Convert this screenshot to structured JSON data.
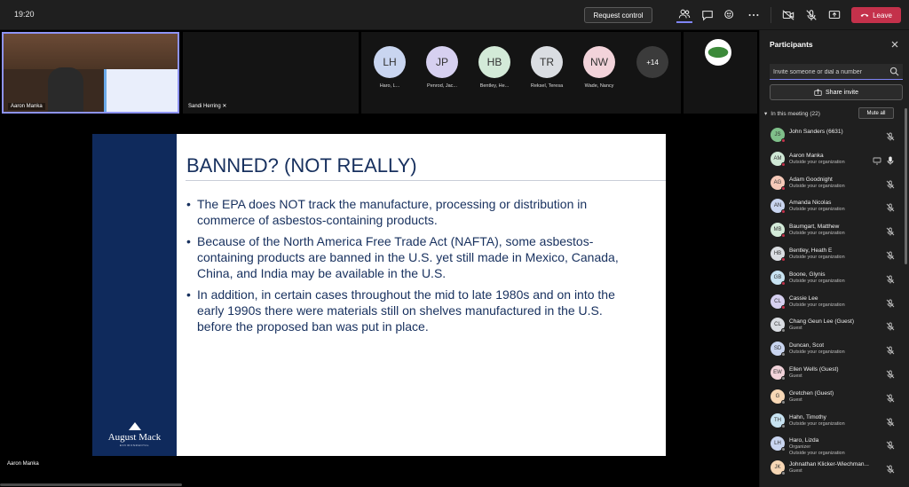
{
  "topbar": {
    "clock": "19:20",
    "request_control": "Request control",
    "leave": "Leave"
  },
  "videos": {
    "self_name": "Aaron Manka",
    "sandi_name": "Sandi Herring",
    "more_count": "+14",
    "tiles": [
      {
        "initials": "LH",
        "caption": "Haro, L...",
        "color": "#c9d5f0"
      },
      {
        "initials": "JP",
        "caption": "Penrod, Jac...",
        "color": "#d6d0f0"
      },
      {
        "initials": "HB",
        "caption": "Bentley, He...",
        "color": "#d3ead8"
      },
      {
        "initials": "TR",
        "caption": "Reksel, Teresa",
        "color": "#dadde2"
      },
      {
        "initials": "NW",
        "caption": "Wade, Nancy",
        "color": "#f2d3da"
      }
    ]
  },
  "slide": {
    "title": "BANNED? (NOT REALLY)",
    "bullets": [
      "The EPA does NOT track the manufacture, processing or distribution in commerce of asbestos-containing products.",
      "Because of the North America Free Trade Act (NAFTA), some asbestos-containing products are banned in the U.S. yet still made in Mexico, Canada, China, and India may be available in the U.S.",
      "In addition, in certain cases throughout the mid to late 1980s and on into the early 1990s there were materials still on shelves manufactured in the U.S. before the proposed ban was put in place."
    ],
    "logo_word": "August Mack",
    "logo_sub": "ENVIRONMENTAL",
    "presenter_name": "Aaron Manka"
  },
  "panel": {
    "title": "Participants",
    "invite_placeholder": "Invite someone or dial a number",
    "share_invite": "Share invite",
    "section": "In this meeting (22)",
    "mute_all": "Mute all",
    "participants": [
      {
        "initials": "JS",
        "name": "John Sanders (6631)",
        "sub": "",
        "sub2": "",
        "color": "#7fc08a",
        "dot": "#c4314b"
      },
      {
        "initials": "AM",
        "name": "Aaron Manka",
        "sub": "Outside your organization",
        "sub2": "",
        "color": "#cfe8d5",
        "dot": "#c4314b"
      },
      {
        "initials": "AG",
        "name": "Adam Goodnight",
        "sub": "Outside your organization",
        "sub2": "",
        "color": "#f6c9b8",
        "dot": "#c4314b"
      },
      {
        "initials": "AN",
        "name": "Amanda Nicolas",
        "sub": "Outside your organization",
        "sub2": "",
        "color": "#c9d5f0",
        "dot": "#c4314b"
      },
      {
        "initials": "MB",
        "name": "Baumgart, Matthew",
        "sub": "Outside your organization",
        "sub2": "",
        "color": "#d3ead8",
        "dot": "#c4314b"
      },
      {
        "initials": "HB",
        "name": "Bentley, Heath E",
        "sub": "Outside your organization",
        "sub2": "",
        "color": "#dadde2",
        "dot": "#c4314b"
      },
      {
        "initials": "GB",
        "name": "Boone, Glynis",
        "sub": "Outside your organization",
        "sub2": "",
        "color": "#c8e3f2",
        "dot": "#c4314b"
      },
      {
        "initials": "CL",
        "name": "Cassie Lee",
        "sub": "Outside your organization",
        "sub2": "",
        "color": "#d6d0f0",
        "dot": "#c4314b"
      },
      {
        "initials": "CL",
        "name": "Chang Geun Lee (Guest)",
        "sub": "Guest",
        "sub2": "",
        "color": "#dadde2",
        "dot": "#8a8a8a"
      },
      {
        "initials": "SD",
        "name": "Duncan, Scot",
        "sub": "Outside your organization",
        "sub2": "",
        "color": "#c9d5f0",
        "dot": "#8a8a8a"
      },
      {
        "initials": "EW",
        "name": "Ellen Wells (Guest)",
        "sub": "Guest",
        "sub2": "",
        "color": "#f2d3da",
        "dot": "#8a8a8a"
      },
      {
        "initials": "G",
        "name": "Gretchen (Guest)",
        "sub": "Guest",
        "sub2": "",
        "color": "#f7d7b5",
        "dot": "#8a8a8a"
      },
      {
        "initials": "TH",
        "name": "Hahn, Timothy",
        "sub": "Outside your organization",
        "sub2": "",
        "color": "#c8e3f2",
        "dot": "#8a8a8a"
      },
      {
        "initials": "LH",
        "name": "Haro, Lizda",
        "sub": "Organizer",
        "sub2": "Outside your organization",
        "color": "#c9d5f0",
        "dot": "#8a8a8a"
      },
      {
        "initials": "JK",
        "name": "Johnathan Klicker-Wiechman...",
        "sub": "Guest",
        "sub2": "",
        "color": "#f7d7b5",
        "dot": "#8a8a8a"
      }
    ],
    "bottom_sub": "Outside your organization"
  }
}
